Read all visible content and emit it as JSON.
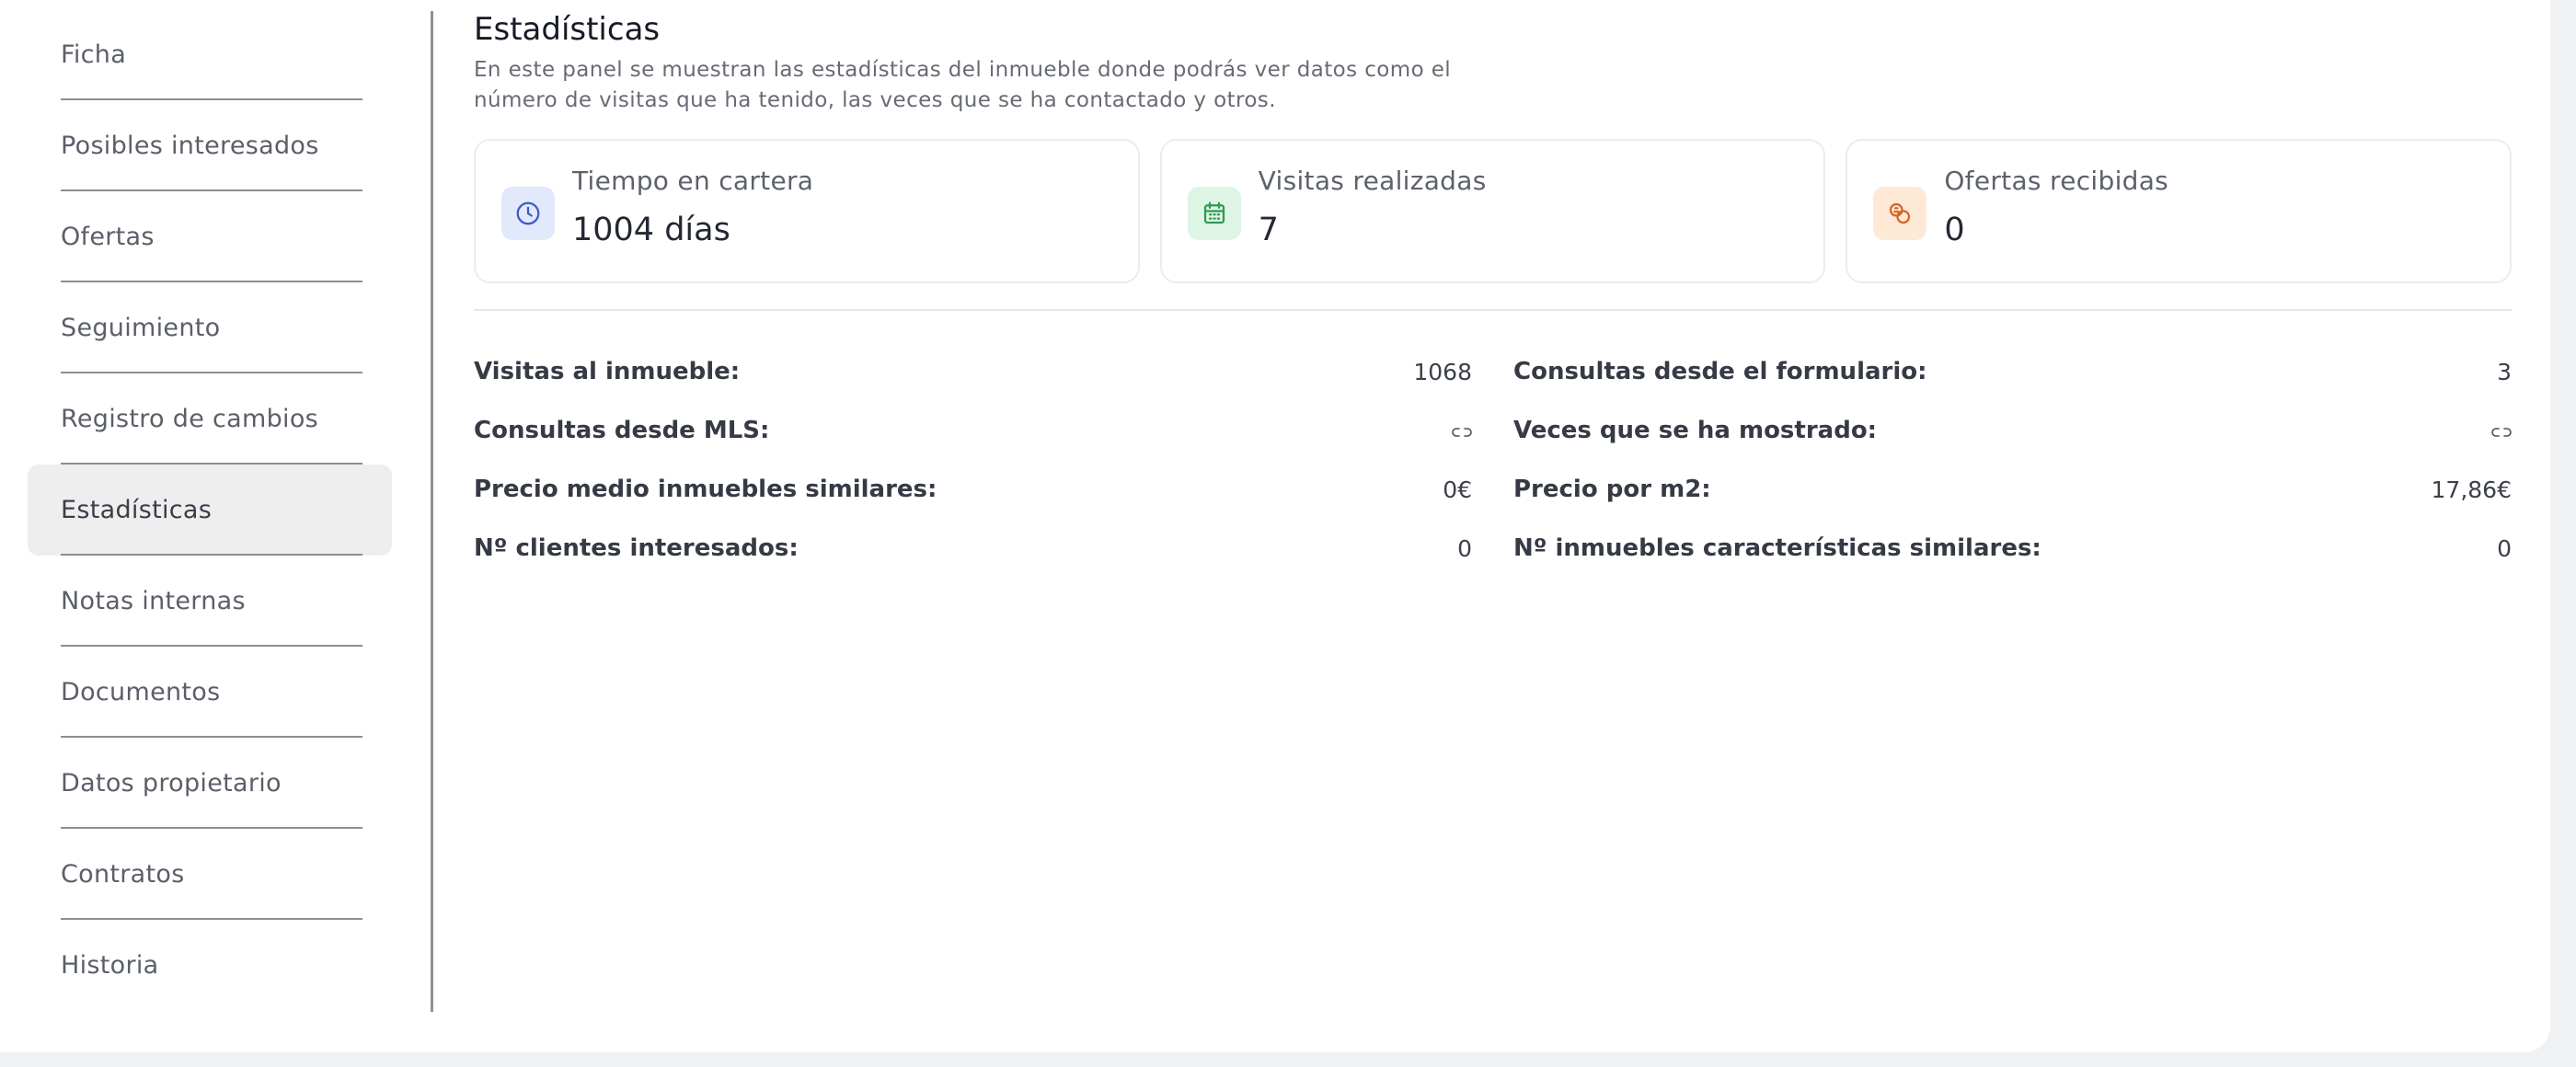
{
  "sidebar": {
    "items": [
      {
        "label": "Ficha"
      },
      {
        "label": "Posibles interesados"
      },
      {
        "label": "Ofertas"
      },
      {
        "label": "Seguimiento"
      },
      {
        "label": "Registro de cambios"
      },
      {
        "label": "Estadísticas",
        "active": true
      },
      {
        "label": "Notas internas"
      },
      {
        "label": "Documentos"
      },
      {
        "label": "Datos propietario"
      },
      {
        "label": "Contratos"
      },
      {
        "label": "Historia"
      }
    ]
  },
  "main": {
    "title": "Estadísticas",
    "description_line1": "En este panel se muestran las estadísticas del inmueble donde podrás ver datos como el",
    "description_line2": "número de visitas que ha tenido, las veces que se ha contactado y otros.",
    "stats": [
      {
        "label": "Tiempo en cartera",
        "value": "1004 días",
        "icon": "clock-icon",
        "color": "#3b5bc4"
      },
      {
        "label": "Visitas realizadas",
        "value": "7",
        "icon": "calendar-icon",
        "color": "#2f9a52"
      },
      {
        "label": "Ofertas recibidas",
        "value": "0",
        "icon": "coins-icon",
        "color": "#d4662a"
      }
    ],
    "details": {
      "visitas_inmueble": {
        "label": "Visitas al inmueble:",
        "value": "1068"
      },
      "consultas_formulario": {
        "label": "Consultas desde el formulario:",
        "value": "3"
      },
      "consultas_mls": {
        "label": "Consultas desde MLS:",
        "icon": "link-icon"
      },
      "veces_mostrado": {
        "label": "Veces que se ha mostrado:",
        "icon": "link-icon"
      },
      "precio_medio": {
        "label": "Precio medio inmuebles similares:",
        "value": "0€"
      },
      "precio_m2": {
        "label": "Precio por m2:",
        "value": "17,86€"
      },
      "clientes_interesados": {
        "label": "Nº clientes interesados:",
        "value": "0"
      },
      "inmuebles_similares": {
        "label": "Nº inmuebles características similares:",
        "value": "0"
      }
    }
  }
}
